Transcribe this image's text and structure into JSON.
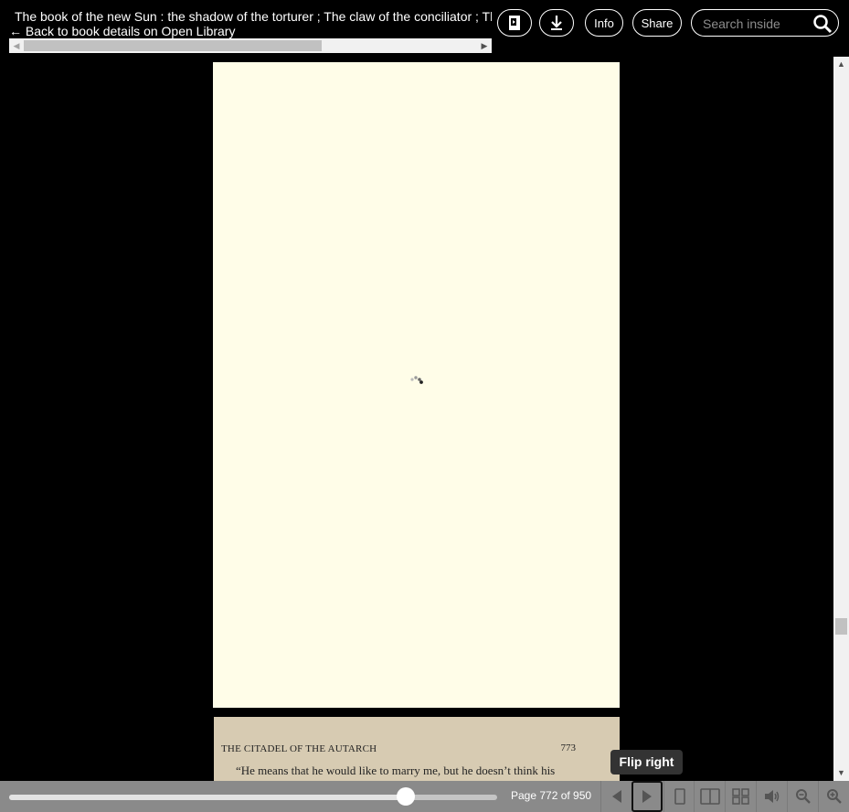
{
  "header": {
    "book_title": "The book of the new Sun : the shadow of the torturer ; The claw of the conciliator ; The sword of the lictor ; The citadel of the autarch",
    "back_link": "← Back to book details on Open Library",
    "info_label": "Info",
    "share_label": "Share",
    "search_placeholder": "Search inside"
  },
  "icons": {
    "read_aloud_page": "page-icon",
    "download": "download-icon",
    "search": "search-icon",
    "flip_left": "arrow-left-icon",
    "flip_right": "arrow-right-icon",
    "one_page": "one-page-view-icon",
    "two_page": "two-page-view-icon",
    "thumbnails": "thumbnail-view-icon",
    "read_aloud": "speaker-icon",
    "zoom_out": "zoom-out-icon",
    "zoom_in": "zoom-in-icon"
  },
  "page": {
    "running_head": "THE CITADEL OF THE AUTARCH",
    "page_number": "773",
    "first_line": "“He means that he would like to marry me, but he doesn’t think his",
    "second_line": "... ... ... ... ... ... ... ..."
  },
  "tooltip": "Flip right",
  "toolbar": {
    "page_indicator": "Page 772 of 950",
    "current_page": 772,
    "total_pages": 950
  },
  "colors": {
    "background": "#000000",
    "page_blank": "#fffde8",
    "page_scan": "#d7cbb2",
    "toolbar": "#8a8a8a"
  }
}
